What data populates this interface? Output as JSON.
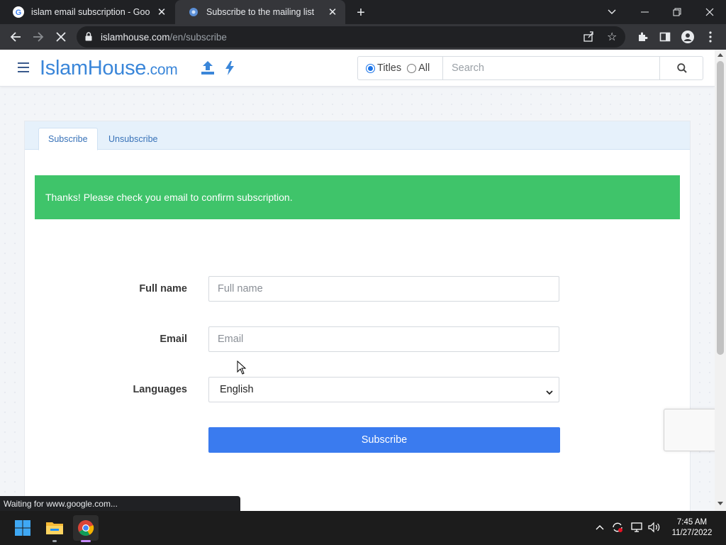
{
  "browser": {
    "tabs": [
      {
        "title": "islam email subscription - Google",
        "active": false
      },
      {
        "title": "Subscribe to the mailing list",
        "active": true
      }
    ],
    "url_host": "islamhouse.com",
    "url_path": "/en/subscribe",
    "status_text": "Waiting for www.google.com..."
  },
  "site": {
    "logo_main": "IslamHouse",
    "logo_domain": ".com",
    "search": {
      "scope_options": [
        "Titles",
        "All"
      ],
      "selected_scope": "Titles",
      "placeholder": "Search"
    }
  },
  "panel": {
    "tabs": [
      "Subscribe",
      "Unsubscribe"
    ],
    "active_tab": "Subscribe",
    "alert": "Thanks! Please check you email to confirm subscription.",
    "alert_color": "#3fc46a"
  },
  "form": {
    "fullname_label": "Full name",
    "fullname_placeholder": "Full name",
    "email_label": "Email",
    "email_placeholder": "Email",
    "languages_label": "Languages",
    "language_value": "English",
    "submit_label": "Subscribe",
    "submit_color": "#3a7bef"
  },
  "taskbar": {
    "time": "7:45 AM",
    "date": "11/27/2022"
  }
}
